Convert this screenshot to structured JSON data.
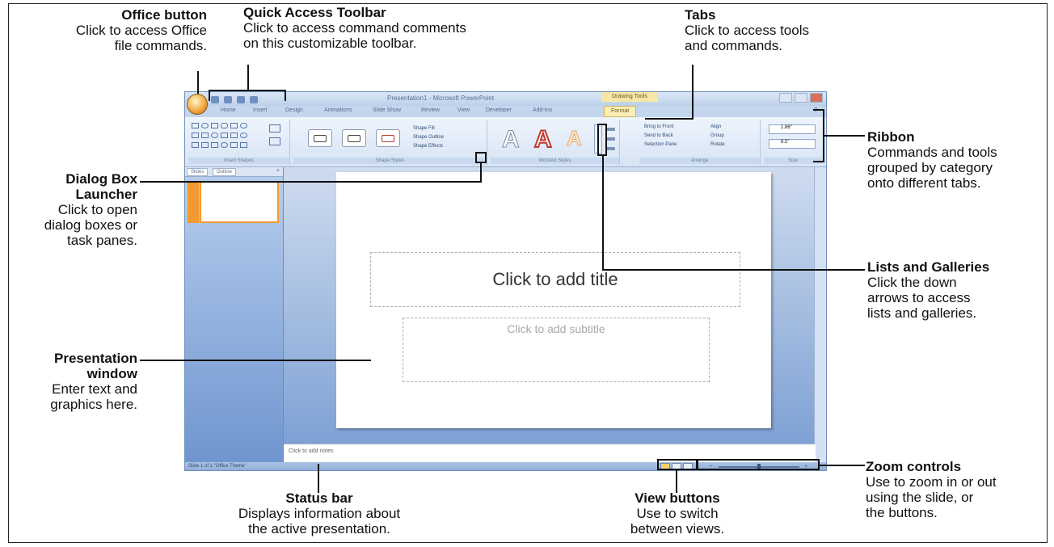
{
  "callouts": {
    "office_button": {
      "title": "Office button",
      "desc1": "Click to access Office",
      "desc2": "file commands."
    },
    "quick_access": {
      "title": "Quick Access Toolbar",
      "desc1": "Click to access command comments",
      "desc2": "on this customizable toolbar."
    },
    "tabs": {
      "title": "Tabs",
      "desc1": "Click to access tools",
      "desc2": "and commands."
    },
    "ribbon": {
      "title": "Ribbon",
      "desc1": "Commands and tools",
      "desc2": "grouped by category",
      "desc3": "onto different tabs."
    },
    "dialog_launcher": {
      "title1": "Dialog Box",
      "title2": "Launcher",
      "desc1": "Click to open",
      "desc2": "dialog boxes or",
      "desc3": "task panes."
    },
    "lists_galleries": {
      "title": "Lists and Galleries",
      "desc1": "Click the down",
      "desc2": "arrows to access",
      "desc3": "lists and galleries."
    },
    "presentation_window": {
      "title1": "Presentation",
      "title2": "window",
      "desc1": "Enter text and",
      "desc2": "graphics here."
    },
    "status_bar": {
      "title": "Status bar",
      "desc1": "Displays information about",
      "desc2": "the active presentation."
    },
    "view_buttons": {
      "title": "View buttons",
      "desc1": "Use to switch",
      "desc2": "between views."
    },
    "zoom_controls": {
      "title": "Zoom controls",
      "desc1": "Use to zoom in or out",
      "desc2": "using the slide, or",
      "desc3": "the buttons."
    }
  },
  "window": {
    "title": "Presentation1 - Microsoft PowerPoint",
    "context_title": "Drawing Tools",
    "tabs": [
      "Home",
      "Insert",
      "Design",
      "Animations",
      "Slide Show",
      "Review",
      "View",
      "Developer",
      "Add-Ins",
      "Format"
    ],
    "active_tab": "Format",
    "ribbon_groups": [
      "Insert Shapes",
      "Shape Styles",
      "WordArt Styles",
      "Arrange",
      "Size"
    ],
    "shape_fill": "Shape Fill",
    "shape_outline": "Shape Outline",
    "shape_effects": "Shape Effects",
    "bring_to_front": "Bring to Front",
    "send_to_back": "Send to Back",
    "selection_pane": "Selection Pane",
    "align": "Align",
    "group": "Group",
    "rotate": "Rotate",
    "height": "1.86\"",
    "width": "8.5\"",
    "pane_tabs": [
      "Slides",
      "Outline"
    ],
    "slide_title_placeholder": "Click to add title",
    "slide_subtitle_placeholder": "Click to add subtitle",
    "notes_placeholder": "Click to add notes",
    "status_left": "Slide 1 of 1    \"Office Theme\""
  },
  "colors": {
    "accent": "#f29a2f",
    "ribbon": "#d7e4f5",
    "pane": "#6f96cf"
  }
}
